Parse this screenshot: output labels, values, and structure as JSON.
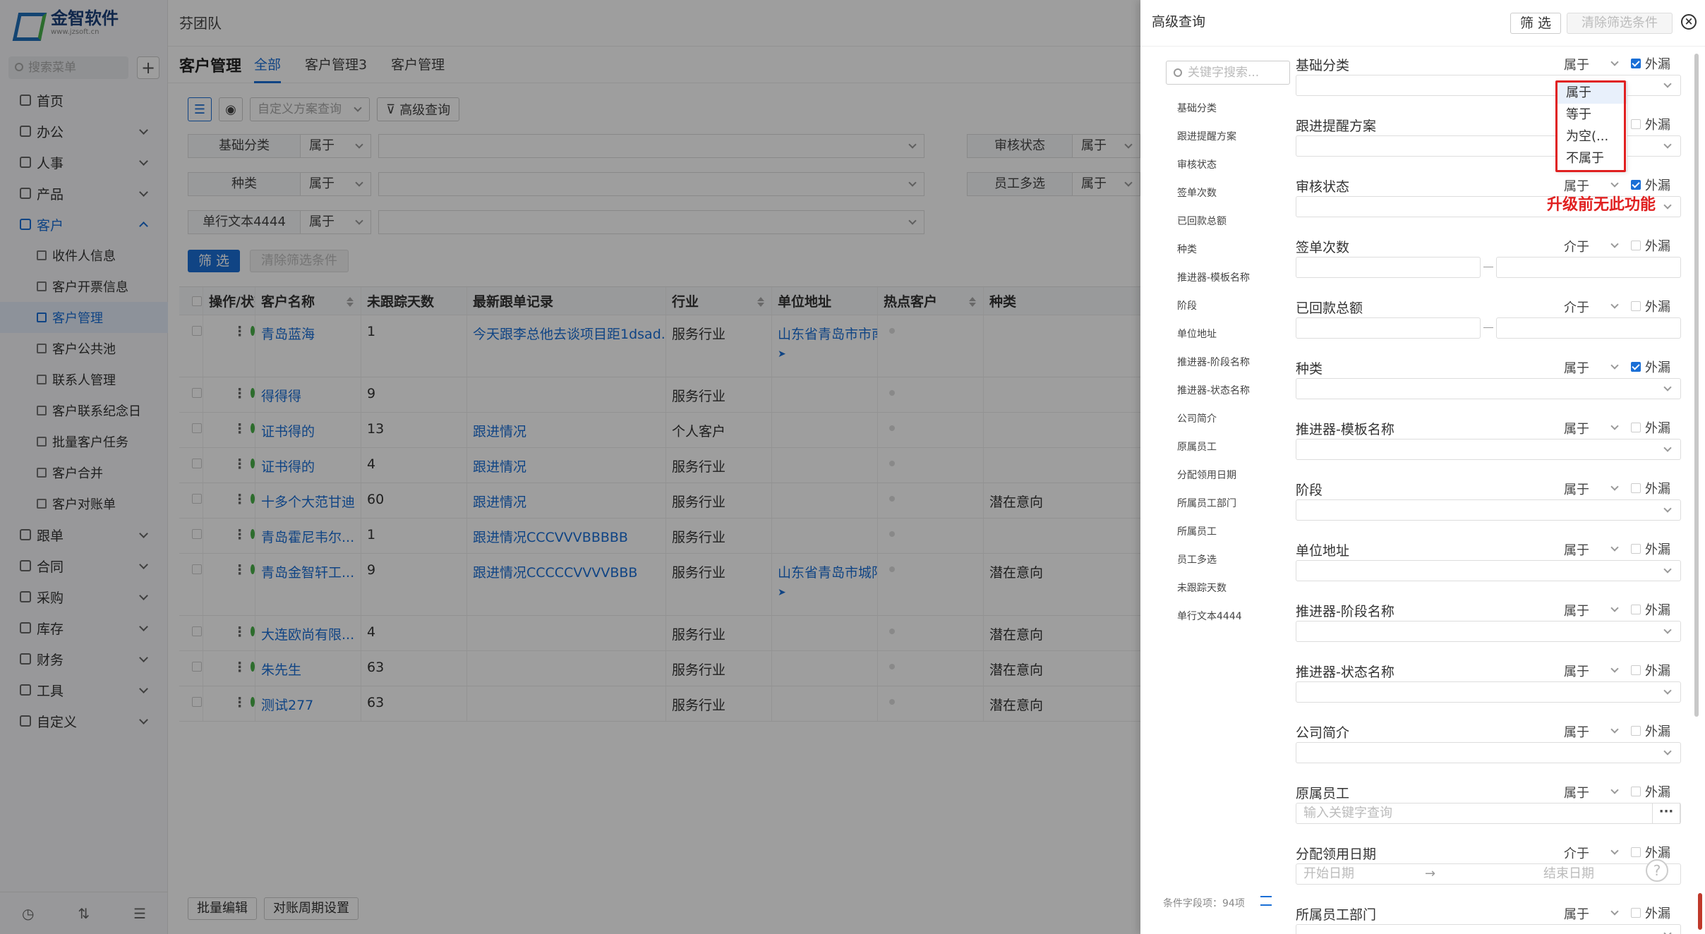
{
  "logo": {
    "name": "金智软件",
    "url_text": "www.jzsoft.cn"
  },
  "sidebar": {
    "search_placeholder": "搜索菜单",
    "items": [
      {
        "label": "首页"
      },
      {
        "label": "办公"
      },
      {
        "label": "人事"
      },
      {
        "label": "产品"
      },
      {
        "label": "客户"
      },
      {
        "label": "跟单"
      },
      {
        "label": "合同"
      },
      {
        "label": "采购"
      },
      {
        "label": "库存"
      },
      {
        "label": "财务"
      },
      {
        "label": "工具"
      },
      {
        "label": "自定义"
      }
    ],
    "sub_items": [
      {
        "label": "收件人信息"
      },
      {
        "label": "客户开票信息"
      },
      {
        "label": "客户管理"
      },
      {
        "label": "客户公共池"
      },
      {
        "label": "联系人管理"
      },
      {
        "label": "客户联系纪念日"
      },
      {
        "label": "批量客户任务"
      },
      {
        "label": "客户合并"
      },
      {
        "label": "客户对账单"
      }
    ]
  },
  "topbar": {
    "team": "芬团队"
  },
  "tabs": {
    "title": "客户管理",
    "items": [
      "全部",
      "客户管理3",
      "客户管理"
    ]
  },
  "toolbar": {
    "scheme_placeholder": "自定义方案查询",
    "advanced_label": "高级查询"
  },
  "filters": [
    {
      "label": "基础分类",
      "op": "属于"
    },
    {
      "label": "种类",
      "op": "属于"
    },
    {
      "label": "单行文本4444",
      "op": "属于"
    }
  ],
  "filters_right": [
    {
      "label": "审核状态",
      "op": "属于"
    },
    {
      "label": "员工多选",
      "op": "属于"
    }
  ],
  "filter_buttons": {
    "apply": "筛 选",
    "clear": "清除筛选条件"
  },
  "table": {
    "headers": [
      "操作/状态",
      "客户名称",
      "未跟踪天数",
      "最新跟单记录",
      "行业",
      "单位地址",
      "热点客户",
      "种类"
    ],
    "rows": [
      {
        "name": "青岛蓝海",
        "days": "1",
        "record": "今天跟李总他去谈项目距1dsad...",
        "industry": "服务行业",
        "addr": "山东省青岛市市南",
        "kind": ""
      },
      {
        "name": "得得得",
        "days": "9",
        "record": "",
        "industry": "服务行业",
        "addr": "",
        "kind": ""
      },
      {
        "name": "证书得的",
        "days": "13",
        "record": "跟进情况",
        "industry": "个人客户",
        "addr": "",
        "kind": ""
      },
      {
        "name": "证书得的",
        "days": "4",
        "record": "跟进情况",
        "industry": "服务行业",
        "addr": "",
        "kind": ""
      },
      {
        "name": "十多个大范甘迪",
        "days": "60",
        "record": "跟进情况",
        "industry": "服务行业",
        "addr": "",
        "kind": "潜在意向"
      },
      {
        "name": "青岛霍尼韦尔...",
        "days": "1",
        "record": "跟进情况CCCVVVBBBBB",
        "industry": "服务行业",
        "addr": "",
        "kind": ""
      },
      {
        "name": "青岛金智轩工...",
        "days": "9",
        "record": "跟进情况CCCCCVVVVBBB",
        "industry": "服务行业",
        "addr": "山东省青岛市城阳",
        "kind": "潜在意向"
      },
      {
        "name": "大连欧尚有限...",
        "days": "4",
        "record": "",
        "industry": "服务行业",
        "addr": "",
        "kind": "潜在意向"
      },
      {
        "name": "朱先生",
        "days": "63",
        "record": "",
        "industry": "服务行业",
        "addr": "",
        "kind": "潜在意向"
      },
      {
        "name": "测试277",
        "days": "63",
        "record": "",
        "industry": "服务行业",
        "addr": "",
        "kind": "潜在意向"
      }
    ]
  },
  "footer": {
    "batch_edit": "批量编辑",
    "period": "对账周期设置"
  },
  "panel": {
    "title": "高级查询",
    "filter_btn": "筛 选",
    "clear_btn": "清除筛选条件",
    "search_placeholder": "关键字搜索...",
    "field_list": [
      "基础分类",
      "跟进提醒方案",
      "审核状态",
      "签单次数",
      "已回款总额",
      "种类",
      "推进器-模板名称",
      "阶段",
      "单位地址",
      "推进器-阶段名称",
      "推进器-状态名称",
      "公司简介",
      "原属员工",
      "分配领用日期",
      "所属员工部门",
      "所属员工",
      "员工多选",
      "未跟踪天数",
      "单行文本4444"
    ],
    "count_label": "条件字段项：94项",
    "leak_label": "外漏",
    "form": [
      {
        "label": "基础分类",
        "op": "属于",
        "checked": true
      },
      {
        "label": "跟进提醒方案",
        "op": "属于",
        "checked": false
      },
      {
        "label": "审核状态",
        "op": "属于",
        "checked": true
      },
      {
        "label": "签单次数",
        "op": "介于",
        "checked": false
      },
      {
        "label": "已回款总额",
        "op": "介于",
        "checked": false
      },
      {
        "label": "种类",
        "op": "属于",
        "checked": true
      },
      {
        "label": "推进器-模板名称",
        "op": "属于",
        "checked": false
      },
      {
        "label": "阶段",
        "op": "属于",
        "checked": false
      },
      {
        "label": "单位地址",
        "op": "属于",
        "checked": false
      },
      {
        "label": "推进器-阶段名称",
        "op": "属于",
        "checked": false
      },
      {
        "label": "推进器-状态名称",
        "op": "属于",
        "checked": false
      },
      {
        "label": "公司简介",
        "op": "属于",
        "checked": false
      },
      {
        "label": "原属员工",
        "op": "属于",
        "checked": false
      },
      {
        "label": "分配领用日期",
        "op": "介于",
        "checked": false
      },
      {
        "label": "所属员工部门",
        "op": "属于",
        "checked": false
      }
    ],
    "keyword_placeholder": "输入关键字查询",
    "date_start": "开始日期",
    "date_end": "结束日期",
    "dropdown": [
      "属于",
      "等于",
      "为空(...",
      "不属于"
    ],
    "annotation": "升级前无此功能"
  }
}
